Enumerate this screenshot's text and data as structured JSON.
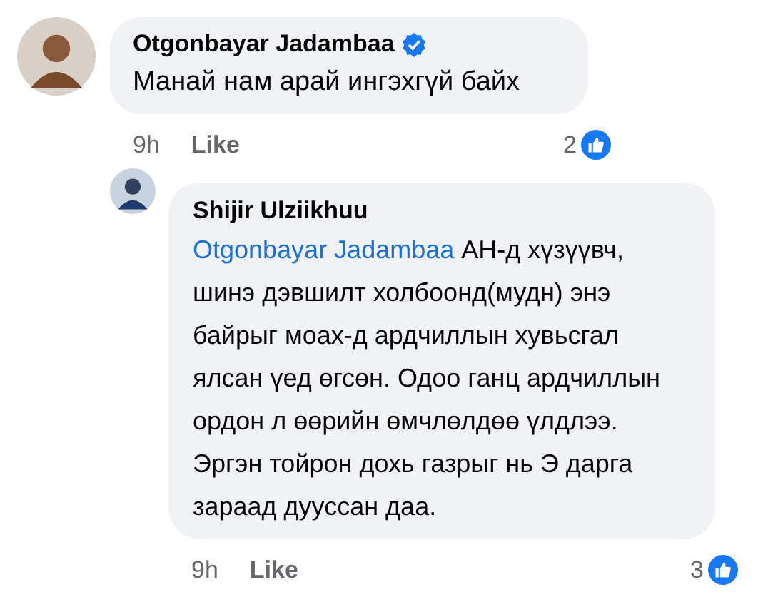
{
  "comments": [
    {
      "author": "Otgonbayar Jadambaa",
      "verified": true,
      "text": "Манай нам арай ингэхгүй байх",
      "time": "9h",
      "like_label": "Like",
      "reactions": "2"
    },
    {
      "author": "Shijir Ulziikhuu",
      "mention": "Otgonbayar Jadambaa",
      "text": "АН-д хүзүүвч, шинэ дэвшилт холбоонд(мудн) энэ байрыг моах-д ардчиллын хувьсгал ялсан үед өгсөн. Одоо ганц ардчиллын ордон л өөрийн өмчлөлдөө үлдлээ. Эргэн тойрон дохь газрыг нь Э дарга зараад дууссан даа.",
      "time": "9h",
      "like_label": "Like",
      "reactions": "3"
    }
  ]
}
